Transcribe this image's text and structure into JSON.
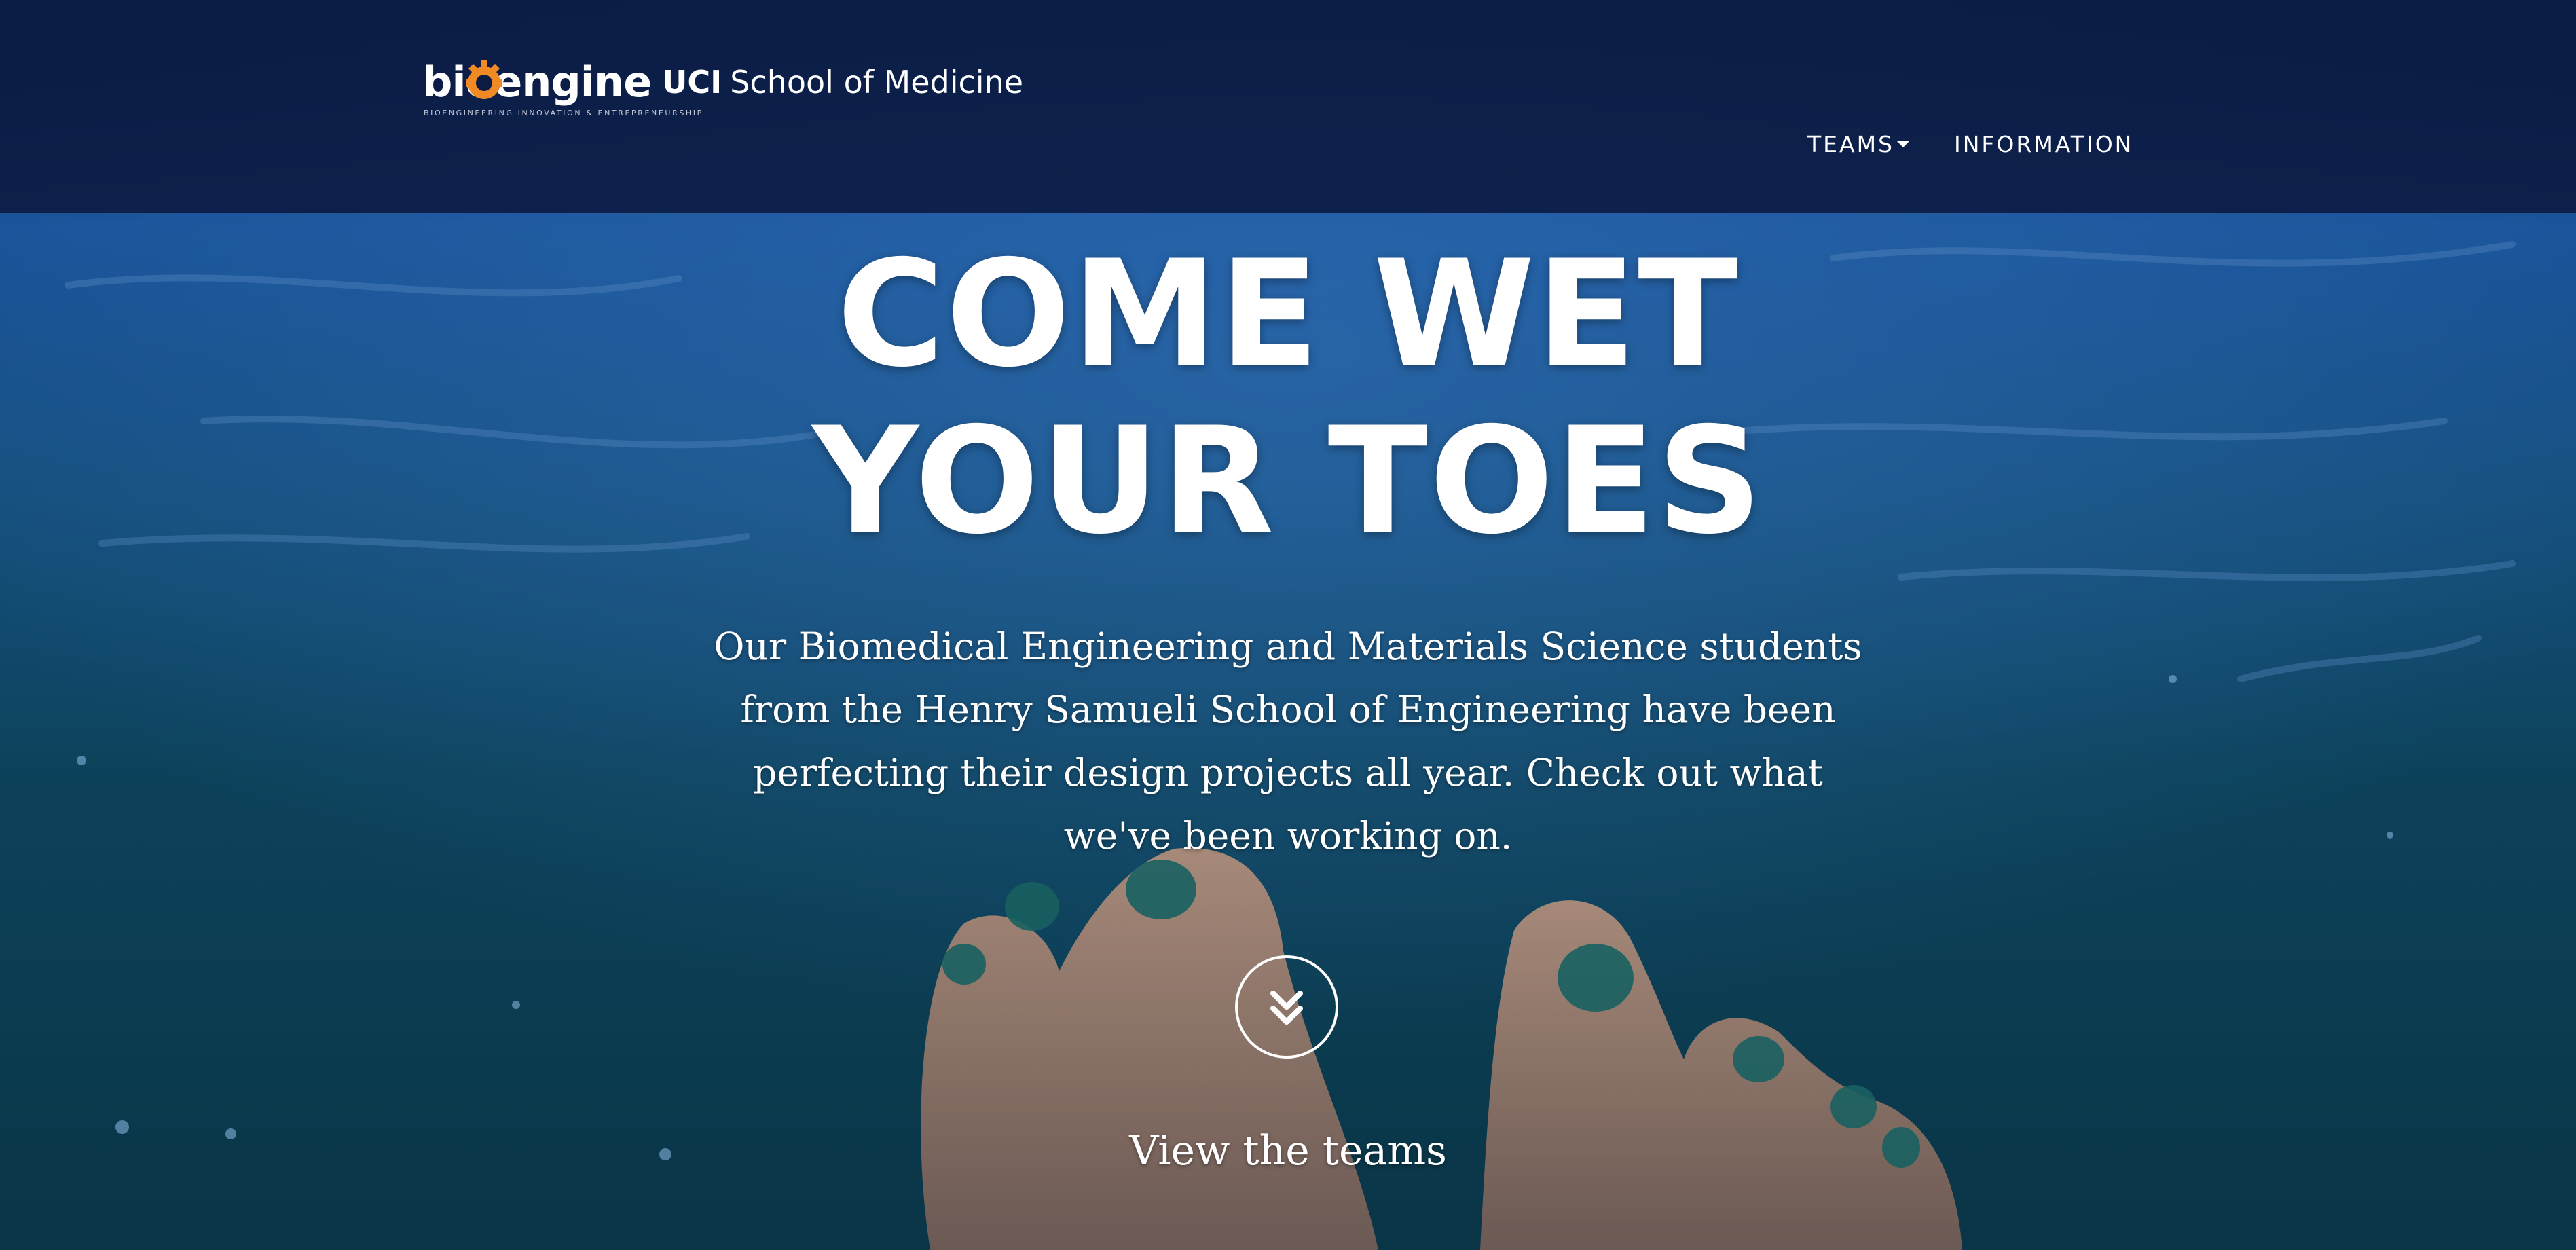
{
  "header": {
    "logo_text": "bioengine",
    "logo_tagline": "BIOENGINEERING INNOVATION & ENTREPRENEURSHIP",
    "uci_label": "UCI",
    "school_label": "School of Medicine"
  },
  "nav": {
    "items": [
      {
        "label": "TEAMS",
        "has_dropdown": true,
        "icon": "caret-down-icon"
      },
      {
        "label": "INFORMATION",
        "has_dropdown": false
      }
    ]
  },
  "hero": {
    "title_line1": "COME WET",
    "title_line2": "YOUR TOES",
    "description": "Our Biomedical Engineering and Materials Science students from the Henry Samueli School of Engineering have been perfecting their design projects all year. Check out what we've been working on.",
    "scroll_icon": "double-chevron-down-icon",
    "cta_label": "View the teams"
  },
  "colors": {
    "header_bg": "#0b1b42",
    "logo_accent": "#f08a24",
    "text": "#ffffff",
    "water_top": "#1f5fb0",
    "water_bottom": "#0c3c4c"
  }
}
